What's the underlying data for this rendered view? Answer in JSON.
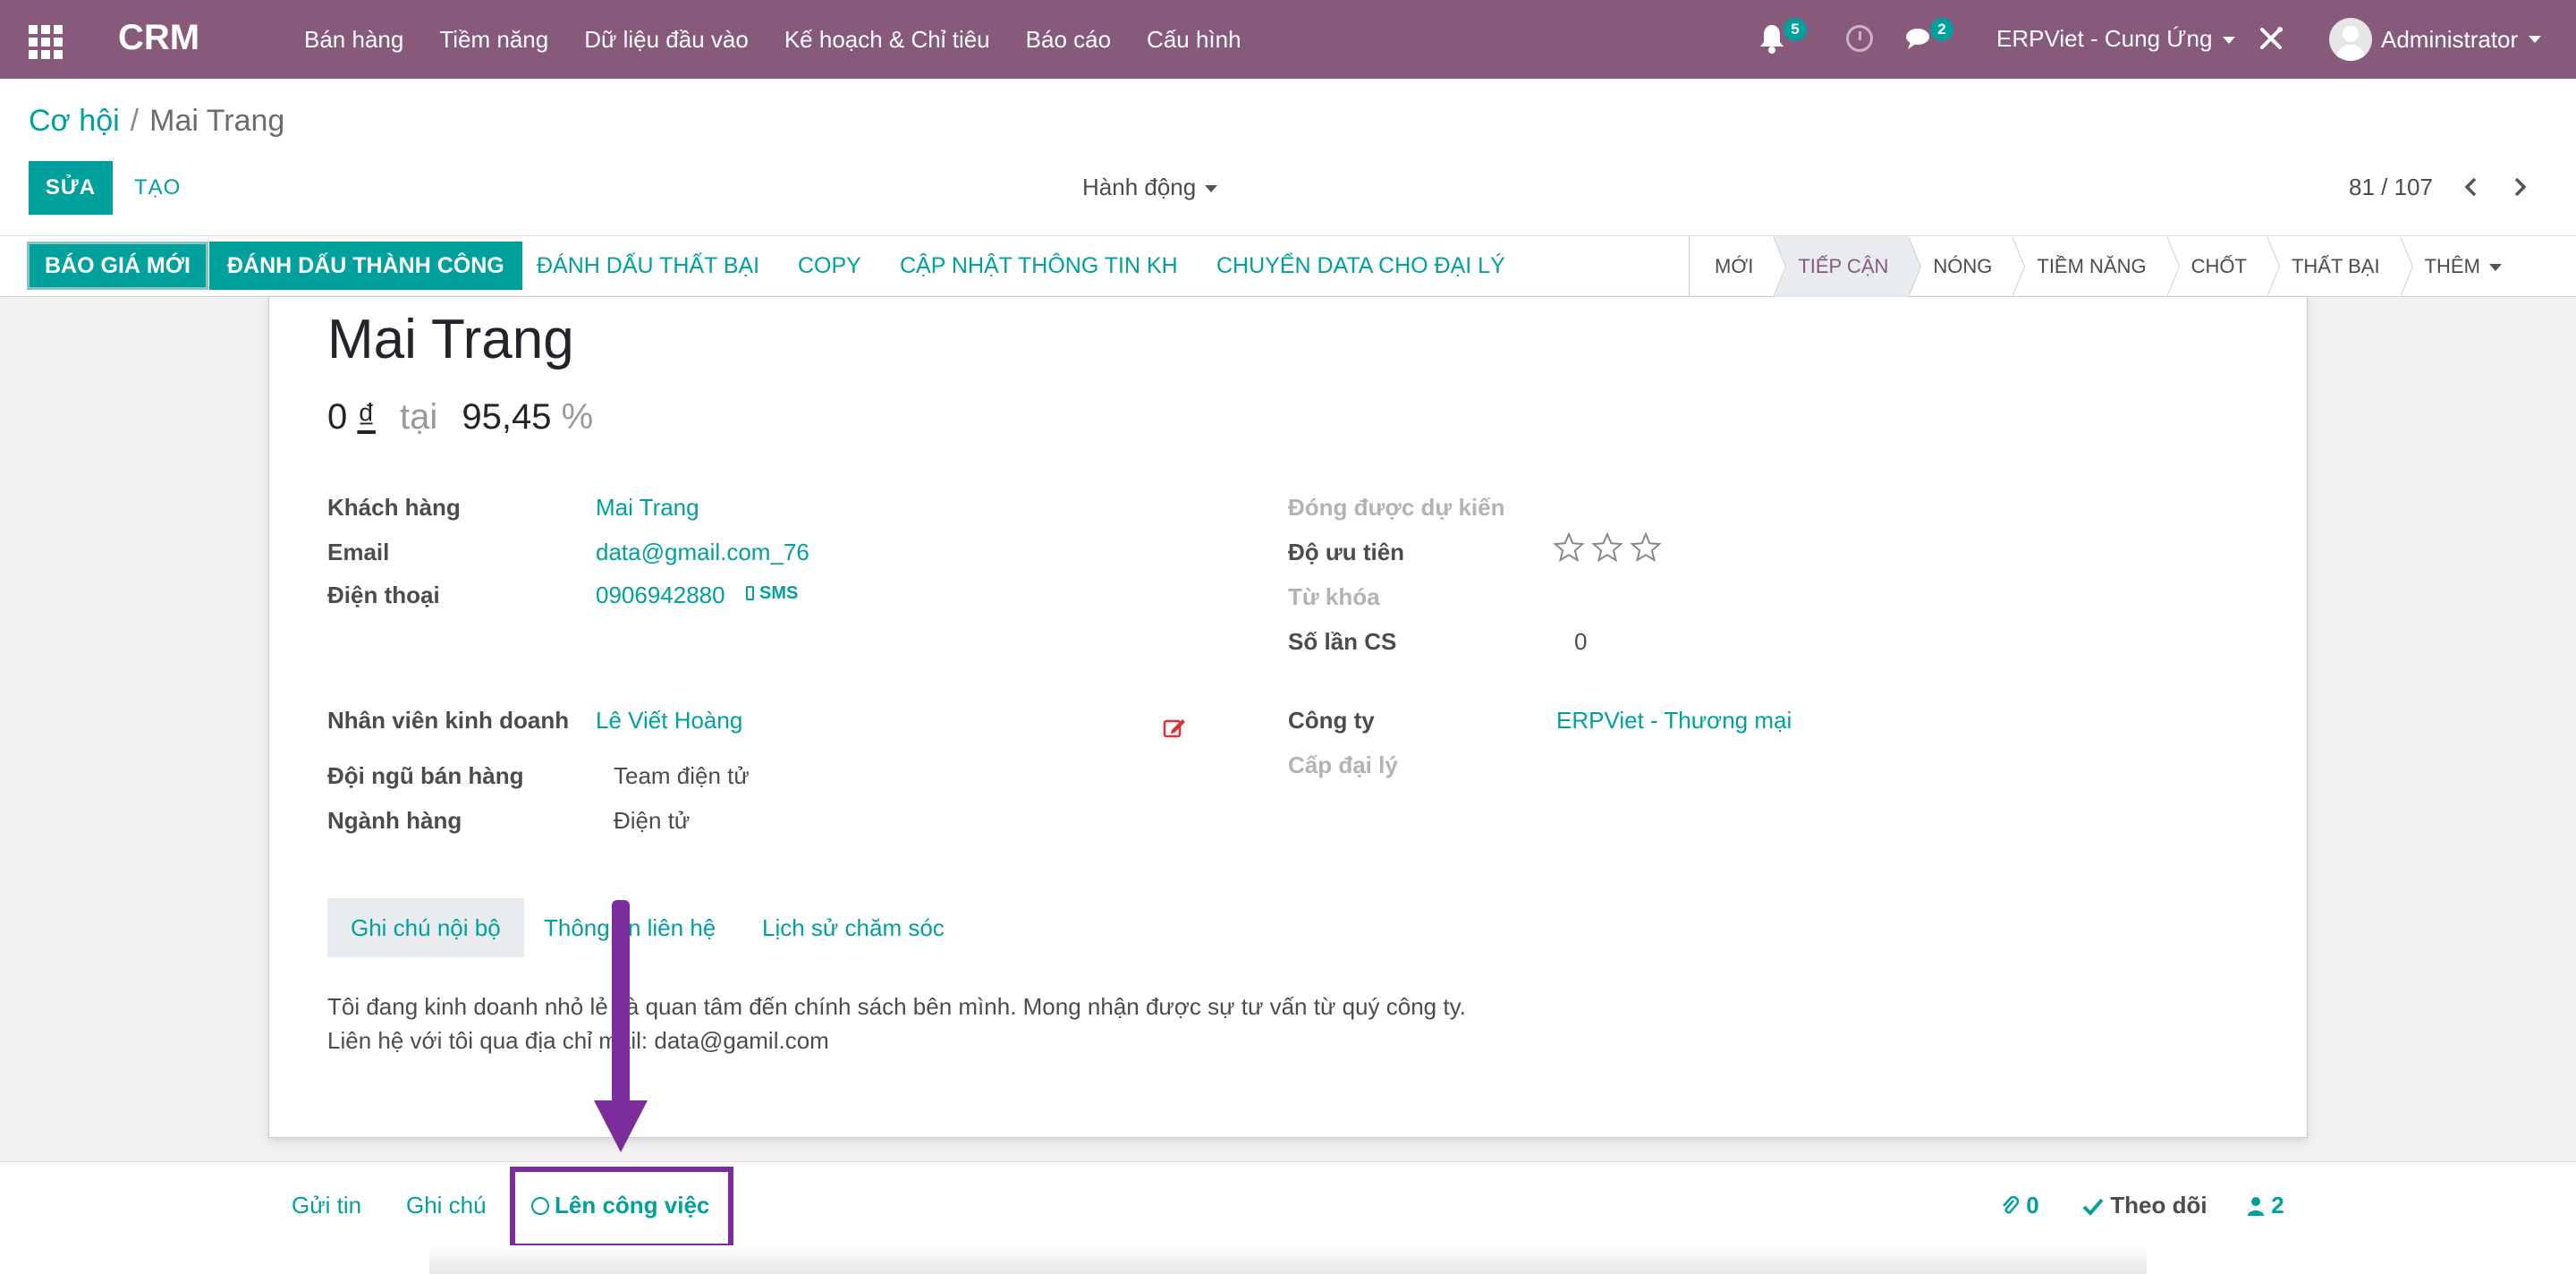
{
  "navbar": {
    "brand": "CRM",
    "menu": [
      "Bán hàng",
      "Tiềm năng",
      "Dữ liệu đầu vào",
      "Kế hoạch & Chỉ tiêu",
      "Báo cáo",
      "Cấu hình"
    ],
    "notification_count": "5",
    "message_count": "2",
    "company": "ERPViet - Cung Ứng",
    "user": "Administrator",
    "bg_color": "#875a7b"
  },
  "breadcrumb": {
    "parent": "Cơ hội",
    "separator": "/",
    "current": "Mai Trang"
  },
  "controls": {
    "edit_label": "SỬA",
    "create_label": "TẠO",
    "action_label": "Hành động",
    "pager": "81 / 107"
  },
  "statusbar": {
    "buttons": [
      "BÁO GIÁ MỚI",
      "ĐÁNH DẤU THÀNH CÔNG",
      "ĐÁNH DẤU THẤT BẠI",
      "COPY",
      "CẬP NHẬT THÔNG TIN KH",
      "CHUYỂN DATA CHO ĐẠI LÝ"
    ],
    "stages": [
      "MỚI",
      "TIẾP CẬN",
      "NÓNG",
      "TIỀM NĂNG",
      "CHỐT",
      "THẤT BẠI",
      "THÊM"
    ],
    "active_stage": "TIẾP CẬN"
  },
  "record": {
    "title": "Mai Trang",
    "revenue": "0",
    "currency": "₫",
    "at_label": "tại",
    "probability": "95,45",
    "percent": "%"
  },
  "fields": {
    "customer_label": "Khách hàng",
    "customer": "Mai Trang",
    "email_label": "Email",
    "email": "data@gmail.com_76",
    "phone_label": "Điện thoại",
    "phone": "0906942880",
    "sms_label": "SMS",
    "salesperson_label": "Nhân viên kinh doanh",
    "salesperson": "Lê Viết Hoàng",
    "team_label": "Đội ngũ bán hàng",
    "team": "Team điện tử",
    "industry_label": "Ngành hàng",
    "industry": "Điện tử",
    "expected_close_label": "Đóng được dự kiến",
    "priority_label": "Độ ưu tiên",
    "priority_stars": 0,
    "keywords_label": "Từ khóa",
    "care_count_label": "Số lần CS",
    "care_count": "0",
    "company_label": "Công ty",
    "company": "ERPViet - Thương mại",
    "agency_label": "Cấp đại lý"
  },
  "tabs": {
    "items": [
      "Ghi chú nội bộ",
      "Thông tin liên hệ",
      "Lịch sử chăm sóc"
    ],
    "active": "Ghi chú nội bộ"
  },
  "note": {
    "line1": "Tôi đang kinh doanh nhỏ lẻ và quan tâm đến chính sách bên mình. Mong nhận được sự tư vấn từ quý công ty.",
    "line2": "Liên hệ với tôi qua địa chỉ mail: data@gamil.com"
  },
  "chatter": {
    "send_message": "Gửi tin",
    "log_note": "Ghi chú",
    "schedule_activity": "Lên công việc",
    "attachments": "0",
    "follow": "Theo dõi",
    "followers": "2"
  },
  "annotation_color": "#7b2d9b"
}
